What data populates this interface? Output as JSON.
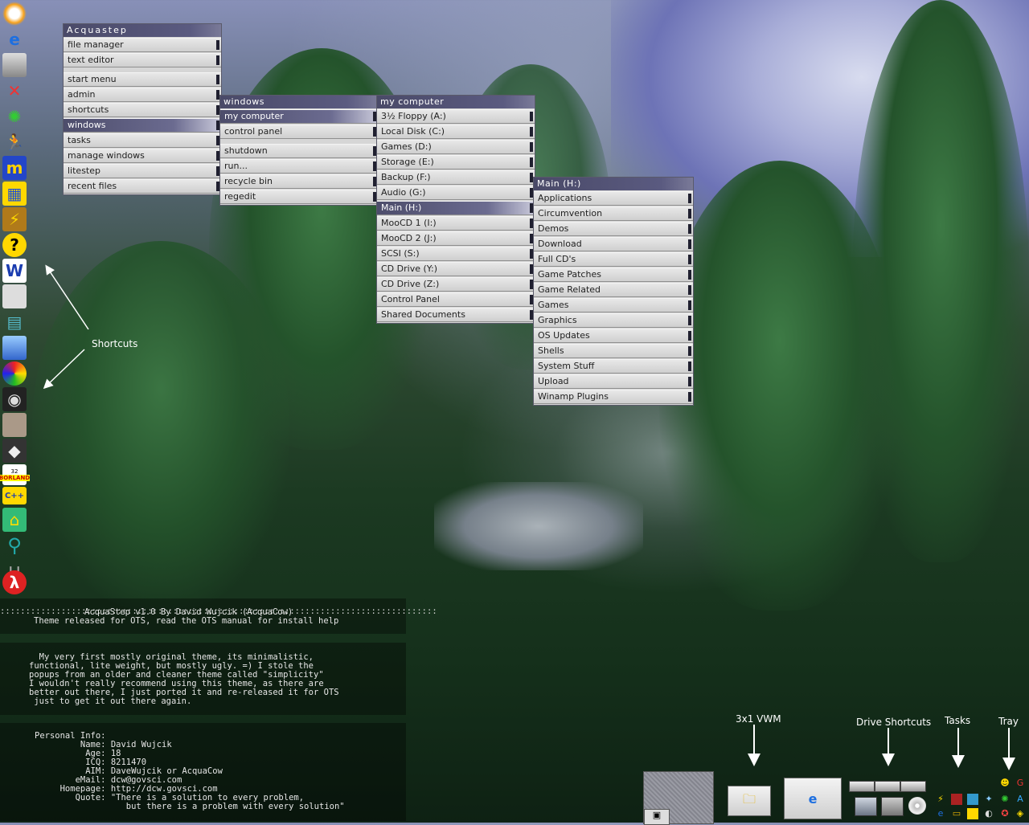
{
  "main_menu": {
    "title": "Acquastep",
    "items": [
      "file manager",
      "text editor",
      "start menu",
      "admin",
      "shortcuts",
      "windows",
      "tasks",
      "manage windows",
      "litestep",
      "recent files"
    ]
  },
  "windows_menu": {
    "title": "windows",
    "items": [
      "my computer",
      "control panel",
      "shutdown",
      "run...",
      "recycle bin",
      "regedit"
    ]
  },
  "computer_menu": {
    "title": "my computer",
    "items": [
      "3½ Floppy (A:)",
      "Local Disk (C:)",
      "Games (D:)",
      "Storage (E:)",
      "Backup (F:)",
      "Audio (G:)",
      "Main (H:)",
      "MooCD 1 (I:)",
      "MooCD 2 (J:)",
      "SCSI (S:)",
      "CD Drive (Y:)",
      "CD Drive (Z:)",
      "Control Panel",
      "Shared Documents"
    ]
  },
  "main_h_menu": {
    "title": "Main (H:)",
    "items": [
      "Applications",
      "Circumvention",
      "Demos",
      "Download",
      "Full CD's",
      "Game Patches",
      "Game Related",
      "Games",
      "Graphics",
      "OS Updates",
      "Shells",
      "System Stuff",
      "Upload",
      "Winamp Plugins"
    ]
  },
  "annotations": {
    "shortcuts": "Shortcuts",
    "vwm": "3x1 VWM",
    "drive_shortcuts": "Drive Shortcuts",
    "tasks": "Tasks",
    "tray": "Tray"
  },
  "shortcut_icons": [
    "sun-icon",
    "internet-explorer-icon",
    "printer-icon",
    "tools-icon",
    "pinwheel-icon",
    "runner-icon",
    "m-logo-icon",
    "gameboy-icon",
    "winamp-icon",
    "yahoo-icon",
    "word-icon",
    "notepad-icon",
    "books-icon",
    "cube-icon",
    "circles-icon",
    "eye-icon",
    "face-icon",
    "cube-diamond-icon",
    "borland-32-icon",
    "borland-cpp-icon",
    "folder-house-icon",
    "key-icon",
    "horseshoe-icon",
    "half-life-icon"
  ],
  "shortcut_labels": {
    "borland": "BORLAND",
    "borland_cpp": "C++",
    "borland_32": "32"
  },
  "console": {
    "header_line1": "AcquaStep v1.0 By David Wujcik (AcquaCow)",
    "header_line2": "Theme released for OTS, read the OTS manual for install help",
    "body": [
      "  My very first mostly original theme, its minimalistic,",
      "functional, lite weight, but mostly ugly. =) I stole the",
      "popups from an older and cleaner theme called \"simplicity\"",
      "I wouldn't really recommend using this theme, as there are",
      "better out there, I just ported it and re-released it for OTS",
      " just to get it out there again."
    ],
    "info": [
      "Personal Info:",
      "         Name: David Wujcik",
      "          Age: 18",
      "          ICQ: 8211470",
      "          AIM: DaveWujcik or AcquaCow",
      "        eMail: dcw@govsci.com",
      "     Homepage: http://dcw.govsci.com",
      "        Quote: \"There is a solution to every problem,",
      "                  but there is a problem with every solution\""
    ]
  },
  "colors": {
    "menu_title": "#4a4a68",
    "menu_bg": "#d6d6d6",
    "selected": "#5a5a80"
  }
}
